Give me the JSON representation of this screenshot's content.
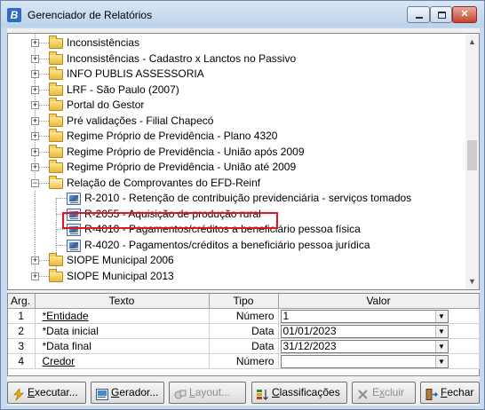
{
  "window": {
    "title": "Gerenciador de Relatórios",
    "app_icon_letter": "B",
    "controls": {
      "minimize": "–",
      "maximize": "□",
      "close": "✕"
    }
  },
  "tree": {
    "nodes": [
      {
        "label": "Inconsistências",
        "type": "folder",
        "expanded": false
      },
      {
        "label": "Inconsistências - Cadastro x Lanctos no Passivo",
        "type": "folder",
        "expanded": false
      },
      {
        "label": "INFO PUBLIS ASSESSORIA",
        "type": "folder",
        "expanded": false
      },
      {
        "label": "LRF - São Paulo (2007)",
        "type": "folder",
        "expanded": false
      },
      {
        "label": "Portal do Gestor",
        "type": "folder",
        "expanded": false
      },
      {
        "label": "Pré validações - Filial Chapecó",
        "type": "folder",
        "expanded": false
      },
      {
        "label": "Regime Próprio de Previdência - Plano 4320",
        "type": "folder",
        "expanded": false
      },
      {
        "label": "Regime Próprio de Previdência - União após 2009",
        "type": "folder",
        "expanded": false
      },
      {
        "label": "Regime Próprio de Previdência - União até 2009",
        "type": "folder",
        "expanded": false
      },
      {
        "label": "Relação de Comprovantes do EFD-Reinf",
        "type": "folder",
        "expanded": true
      },
      {
        "label": "R-2010 - Retenção de contribuição previdenciária - serviços tomados",
        "type": "report"
      },
      {
        "label": "R-2055 - Aquisição de produção rural",
        "type": "report",
        "highlighted": true
      },
      {
        "label": "R-4010 - Pagamentos/créditos a beneficiário pessoa física",
        "type": "report"
      },
      {
        "label": "R-4020 - Pagamentos/créditos a beneficiário pessoa jurídica",
        "type": "report"
      },
      {
        "label": "SIOPE Municipal 2006",
        "type": "folder",
        "expanded": false
      },
      {
        "label": "SIOPE Municipal 2013",
        "type": "folder",
        "expanded": false
      }
    ],
    "scroll_up": "▲",
    "scroll_down": "▼",
    "expand_glyph": "+",
    "collapse_glyph": "−"
  },
  "args": {
    "headers": {
      "arg": "Arg.",
      "texto": "Texto",
      "tipo": "Tipo",
      "valor": "Valor"
    },
    "rows": [
      {
        "arg": "1",
        "texto": "*Entidade",
        "tipo": "Número",
        "valor": "1",
        "underline": true
      },
      {
        "arg": "2",
        "texto": "*Data inicial",
        "tipo": "Data",
        "valor": "01/01/2023",
        "underline": false
      },
      {
        "arg": "3",
        "texto": "*Data final",
        "tipo": "Data",
        "valor": "31/12/2023",
        "underline": false
      },
      {
        "arg": "4",
        "texto": "Credor",
        "tipo": "Número",
        "valor": "",
        "underline": true
      }
    ],
    "dropdown_glyph": "▼"
  },
  "buttons": [
    {
      "key": "executar",
      "label": "Executar...",
      "accel": "E",
      "icon": "lightning-icon",
      "enabled": true
    },
    {
      "key": "gerador",
      "label": "Gerador...",
      "accel": "G",
      "icon": "report-chart-icon",
      "enabled": true
    },
    {
      "key": "layout",
      "label": "Layout...",
      "accel": "L",
      "icon": "layout-icon",
      "enabled": false
    },
    {
      "key": "classificacoes",
      "label": "Classificações",
      "accel": "C",
      "icon": "sort-icon",
      "enabled": true
    },
    {
      "key": "excluir",
      "label": "Excluir",
      "accel": "x",
      "icon": "delete-icon",
      "enabled": false
    },
    {
      "key": "fechar",
      "label": "Fechar",
      "accel": "F",
      "icon": "exit-door-icon",
      "enabled": true
    }
  ],
  "colors": {
    "highlight_border": "#e1141f",
    "window_frame": "#c7d9ee"
  }
}
